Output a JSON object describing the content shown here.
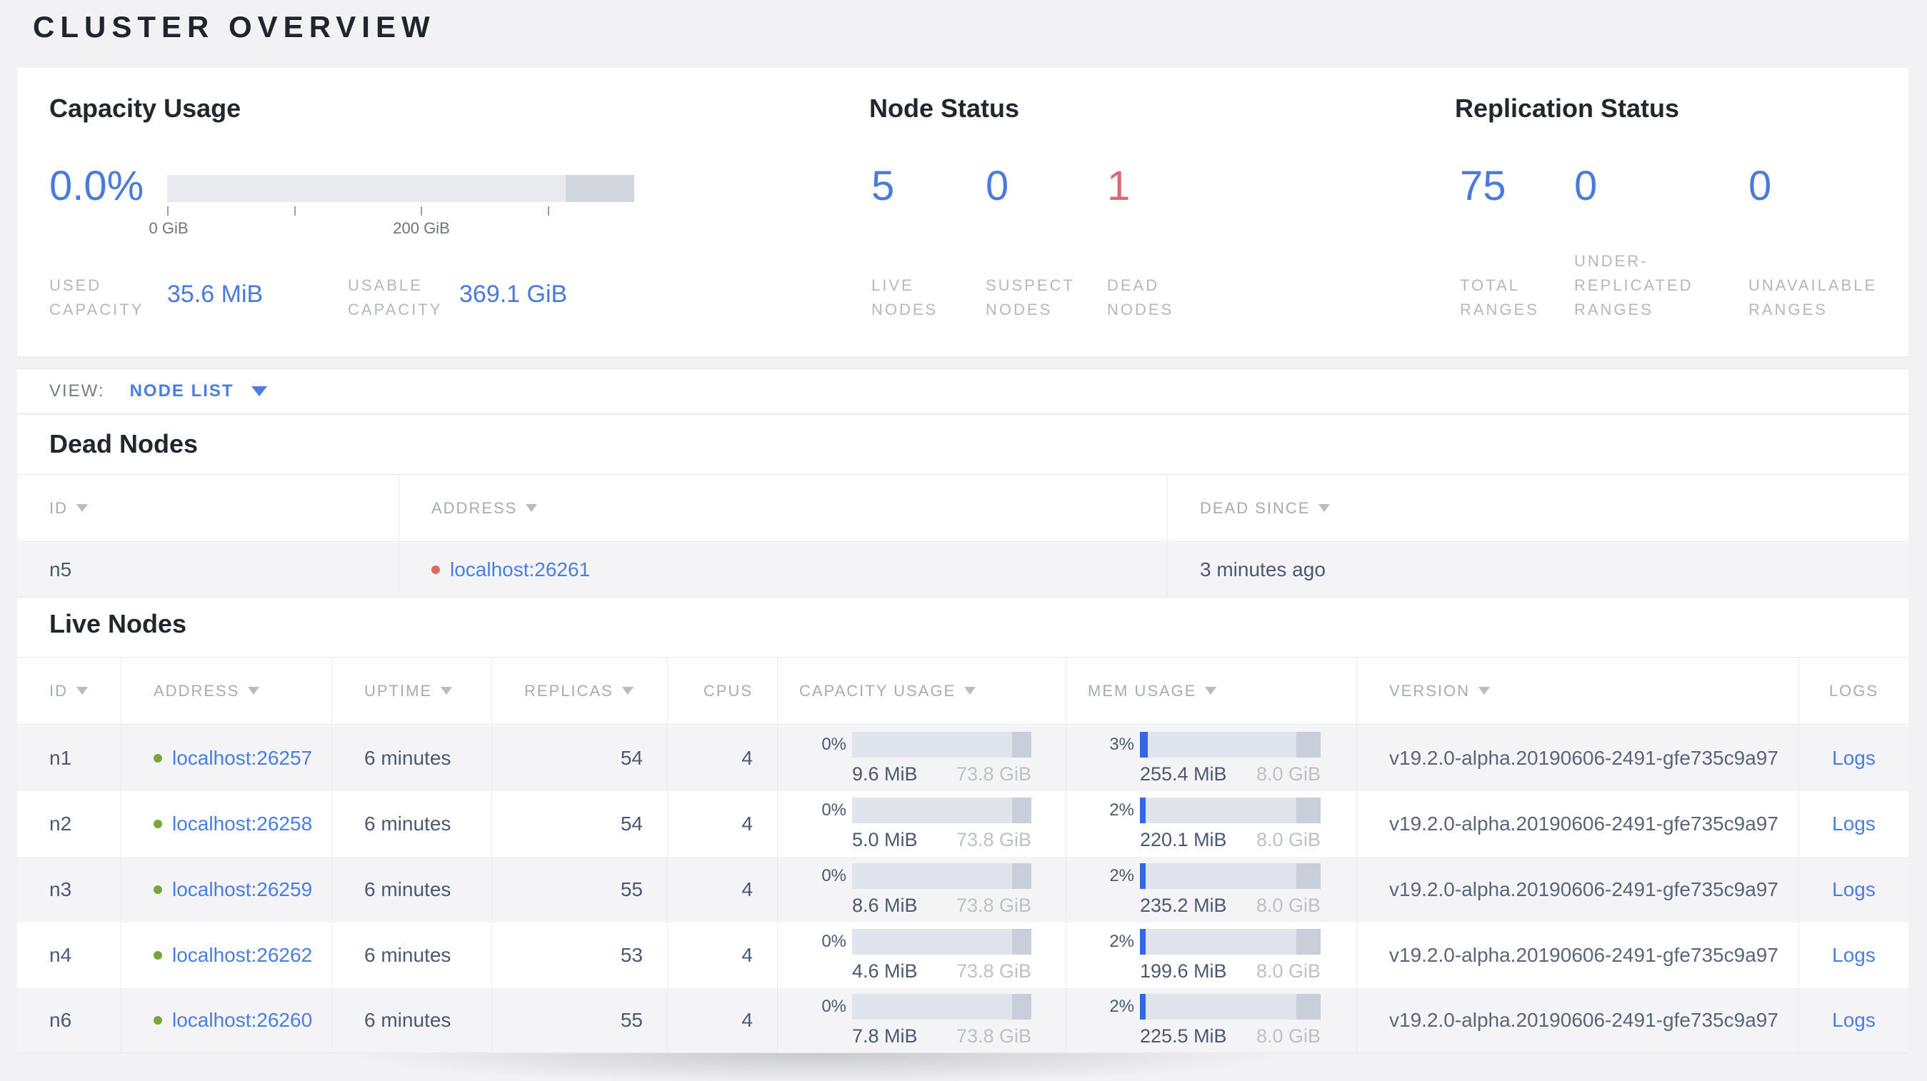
{
  "page": {
    "title": "CLUSTER OVERVIEW"
  },
  "summary": {
    "capacity": {
      "title": "Capacity Usage",
      "percent": "0.0%",
      "axis": [
        "0 GiB",
        "200 GiB"
      ],
      "used": {
        "label1": "USED",
        "label2": "CAPACITY",
        "value": "35.6 MiB"
      },
      "usable": {
        "label1": "USABLE",
        "label2": "CAPACITY",
        "value": "369.1 GiB"
      }
    },
    "node_status": {
      "title": "Node Status",
      "live": {
        "value": "5",
        "line1": "LIVE",
        "line2": "NODES"
      },
      "suspect": {
        "value": "0",
        "line1": "SUSPECT",
        "line2": "NODES"
      },
      "dead": {
        "value": "1",
        "line1": "DEAD",
        "line2": "NODES"
      }
    },
    "replication": {
      "title": "Replication Status",
      "total": {
        "value": "75",
        "line1": "TOTAL",
        "line2": "RANGES"
      },
      "under_replicated": {
        "value": "0",
        "line1": "UNDER-",
        "line2": "REPLICATED",
        "line3": "RANGES"
      },
      "unavailable": {
        "value": "0",
        "line1": "UNAVAILABLE",
        "line2": "RANGES"
      }
    }
  },
  "view_bar": {
    "label": "VIEW:",
    "selected": "NODE LIST"
  },
  "dead_nodes": {
    "title": "Dead Nodes",
    "columns": {
      "id": "ID",
      "address": "ADDRESS",
      "dead_since": "DEAD SINCE"
    },
    "rows": [
      {
        "id": "n5",
        "address": "localhost:26261",
        "dead_since": "3 minutes ago"
      }
    ]
  },
  "live_nodes": {
    "title": "Live Nodes",
    "columns": {
      "id": "ID",
      "address": "ADDRESS",
      "uptime": "UPTIME",
      "replicas": "REPLICAS",
      "cpus": "CPUS",
      "capacity": "CAPACITY USAGE",
      "mem": "MEM USAGE",
      "version": "VERSION",
      "logs": "LOGS"
    },
    "rows": [
      {
        "id": "n1",
        "address": "localhost:26257",
        "uptime": "6 minutes",
        "replicas": "54",
        "cpus": "4",
        "capacity_pct": "0%",
        "capacity_used": "9.6 MiB",
        "capacity_total": "73.8 GiB",
        "mem_pct": "3%",
        "mem_used": "255.4 MiB",
        "mem_total": "8.0 GiB",
        "version": "v19.2.0-alpha.20190606-2491-gfe735c9a97",
        "logs": "Logs"
      },
      {
        "id": "n2",
        "address": "localhost:26258",
        "uptime": "6 minutes",
        "replicas": "54",
        "cpus": "4",
        "capacity_pct": "0%",
        "capacity_used": "5.0 MiB",
        "capacity_total": "73.8 GiB",
        "mem_pct": "2%",
        "mem_used": "220.1 MiB",
        "mem_total": "8.0 GiB",
        "version": "v19.2.0-alpha.20190606-2491-gfe735c9a97",
        "logs": "Logs"
      },
      {
        "id": "n3",
        "address": "localhost:26259",
        "uptime": "6 minutes",
        "replicas": "55",
        "cpus": "4",
        "capacity_pct": "0%",
        "capacity_used": "8.6 MiB",
        "capacity_total": "73.8 GiB",
        "mem_pct": "2%",
        "mem_used": "235.2 MiB",
        "mem_total": "8.0 GiB",
        "version": "v19.2.0-alpha.20190606-2491-gfe735c9a97",
        "logs": "Logs"
      },
      {
        "id": "n4",
        "address": "localhost:26262",
        "uptime": "6 minutes",
        "replicas": "53",
        "cpus": "4",
        "capacity_pct": "0%",
        "capacity_used": "4.6 MiB",
        "capacity_total": "73.8 GiB",
        "mem_pct": "2%",
        "mem_used": "199.6 MiB",
        "mem_total": "8.0 GiB",
        "version": "v19.2.0-alpha.20190606-2491-gfe735c9a97",
        "logs": "Logs"
      },
      {
        "id": "n6",
        "address": "localhost:26260",
        "uptime": "6 minutes",
        "replicas": "55",
        "cpus": "4",
        "capacity_pct": "0%",
        "capacity_used": "7.8 MiB",
        "capacity_total": "73.8 GiB",
        "mem_pct": "2%",
        "mem_used": "225.5 MiB",
        "mem_total": "8.0 GiB",
        "version": "v19.2.0-alpha.20190606-2491-gfe735c9a97",
        "logs": "Logs"
      }
    ]
  },
  "colors": {
    "accent_blue": "#4a7de2",
    "dead_red": "#d96a74",
    "live_green": "#7ba33c"
  }
}
